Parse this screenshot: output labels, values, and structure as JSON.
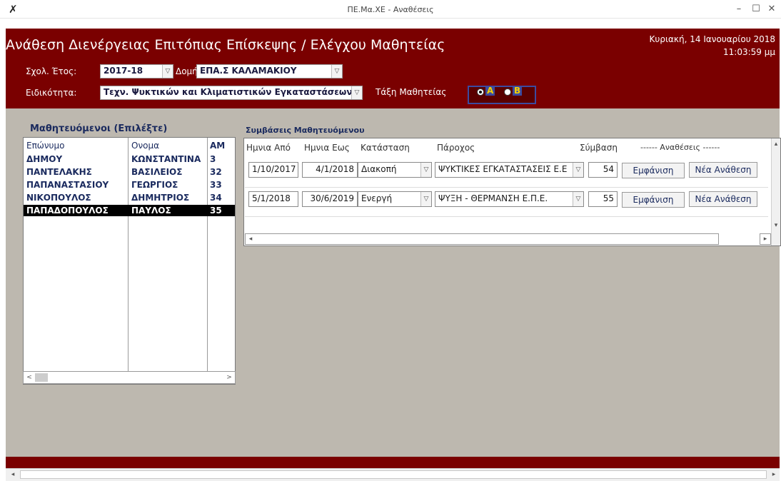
{
  "window": {
    "title": "ΠΕ.Μα.ΧΕ - Αναθέσεις",
    "minimize": "–",
    "maximize": "☐",
    "close": "✕",
    "app_icon": "✗"
  },
  "header": {
    "title": "Ανάθεση Διενέργειας Επιτόπιας Επίσκεψης / Ελέγχου Μαθητείας",
    "date": "Κυριακή, 14 Ιανουαρίου 2018",
    "time": "11:03:59 μμ",
    "school_year_label": "Σχολ. Έτος:",
    "school_year_value": "2017-18",
    "structure_label": "Δομή:",
    "structure_value": "ΕΠΑ.Σ ΚΑΛΑΜΑΚΙΟΥ",
    "specialty_label": "Ειδικότητα:",
    "specialty_value": "Τεχν. Ψυκτικών και Κλιματιστικών Εγκαταστάσεων",
    "class_label": "Τάξη Μαθητείας",
    "class_options": [
      "A",
      "B"
    ],
    "class_selected": "A",
    "dropdown_glyph": "▽"
  },
  "students": {
    "title": "Μαθητευόμενοι (Επιλέξτε)",
    "columns": [
      "Επώνυμο",
      "Ονομα",
      "ΑΜ"
    ],
    "rows": [
      {
        "surname": "ΔΗΜΟΥ",
        "name": "ΚΩΝΣΤΑΝΤΙΝΑ",
        "am": "3"
      },
      {
        "surname": "ΠΑΝΤΕΛΑΚΗΣ",
        "name": "ΒΑΣΙΛΕΙΟΣ",
        "am": "32"
      },
      {
        "surname": "ΠΑΠΑΝΑΣΤΑΣΙΟΥ",
        "name": "ΓΕΩΡΓΙΟΣ",
        "am": "33"
      },
      {
        "surname": "ΝΙΚΟΠΟΥΛΟΣ",
        "name": "ΔΗΜΗΤΡΙΟΣ",
        "am": "34"
      },
      {
        "surname": "ΠΑΠΑΔΟΠΟΥΛΟΣ",
        "name": "ΠΑΥΛΟΣ",
        "am": "35"
      }
    ],
    "selected_index": 4,
    "scroll_left": "<",
    "scroll_right": ">"
  },
  "contracts": {
    "title": "Συμβάσεις Μαθητευόμενου",
    "columns": {
      "from": "Ημνια Από",
      "to": "Ημνια Εως",
      "status": "Κατάσταση",
      "provider": "Πάροχος",
      "contract": "Σύμβαση",
      "assignments": "------ Αναθέσεις ------"
    },
    "rows": [
      {
        "from": "1/10/2017",
        "to": "4/1/2018",
        "status": "Διακοπή",
        "provider": "ΨΥΚΤΙΚΕΣ ΕΓΚΑΤΑΣΤΑΣΕΙΣ Ε.Ε",
        "contract": "54",
        "show_label": "Εμφάνιση",
        "new_label": "Νέα Ανάθεση"
      },
      {
        "from": "5/1/2018",
        "to": "30/6/2019",
        "status": "Ενεργή",
        "provider": "ΨΥΞΗ - ΘΕΡΜΑΝΣΗ Ε.Π.Ε.",
        "contract": "55",
        "show_label": "Εμφάνιση",
        "new_label": "Νέα Ανάθεση"
      }
    ]
  },
  "colors": {
    "header_bg": "#7a0000",
    "main_bg": "#bdb8af",
    "text_dark_blue": "#1a2a5e",
    "selection_bg": "#000000",
    "class_letter": "#f5d000"
  }
}
